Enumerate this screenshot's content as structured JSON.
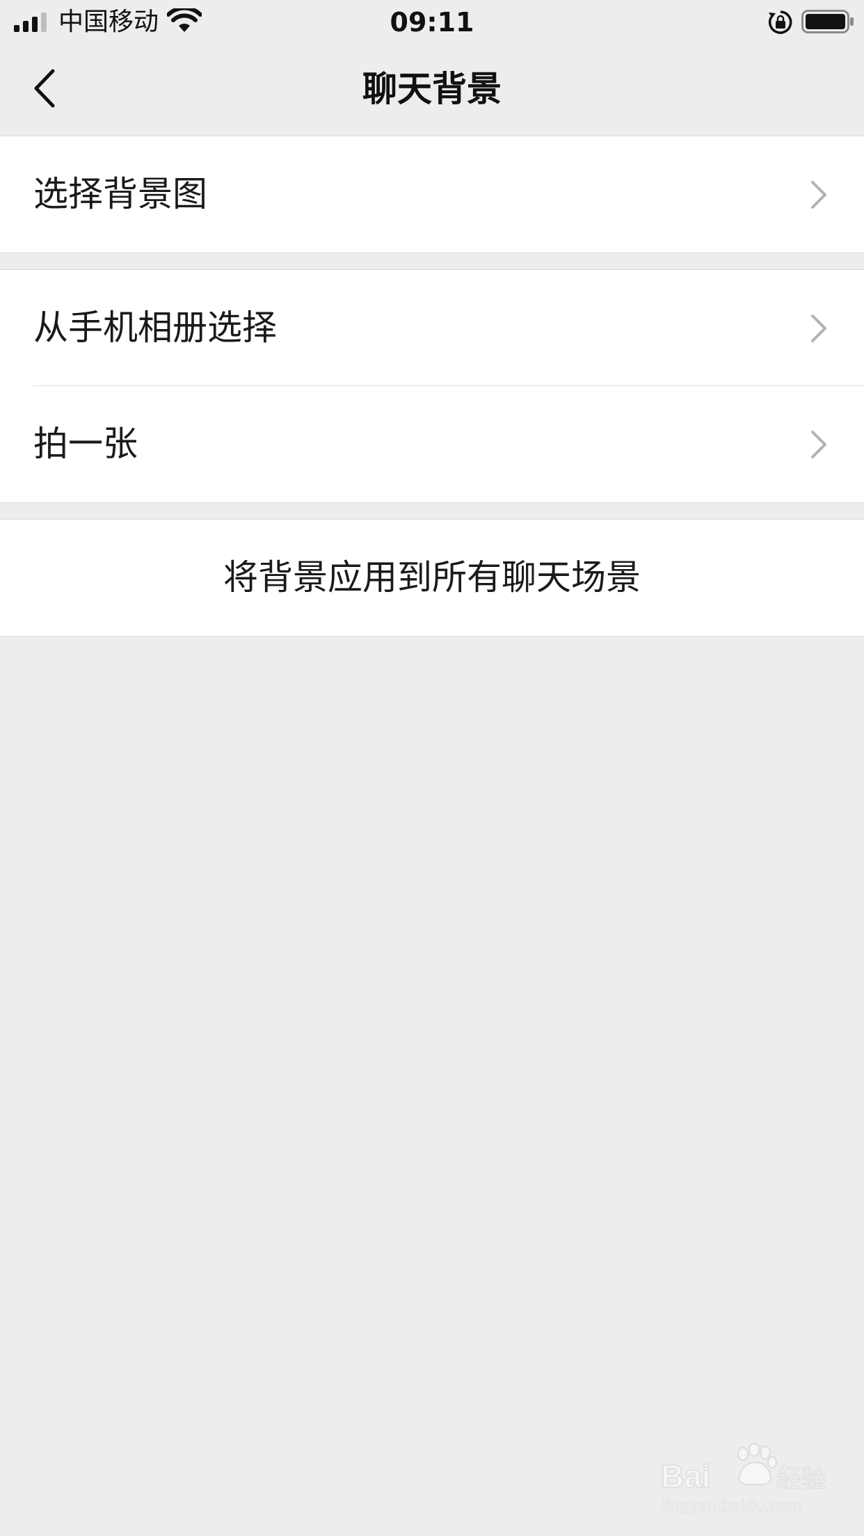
{
  "status_bar": {
    "carrier": "中国移动",
    "time": "09:11",
    "icons": [
      "signal-icon",
      "wifi-icon",
      "rotation-lock-icon",
      "battery-icon"
    ]
  },
  "nav": {
    "title": "聊天背景",
    "back_icon": "chevron-left-icon"
  },
  "groups": [
    {
      "items": [
        {
          "label": "选择背景图",
          "icon": "chevron-right-icon"
        }
      ]
    },
    {
      "items": [
        {
          "label": "从手机相册选择",
          "icon": "chevron-right-icon"
        },
        {
          "label": "拍一张",
          "icon": "chevron-right-icon"
        }
      ]
    },
    {
      "items": [
        {
          "label": "将背景应用到所有聊天场景"
        }
      ]
    }
  ],
  "watermark": {
    "brand": "Bai经验",
    "url": "jingyan.baidu.com"
  },
  "colors": {
    "background": "#ededed",
    "cell_background": "#ffffff",
    "text": "#1a1a1a",
    "chevron": "#b2b2b2"
  }
}
